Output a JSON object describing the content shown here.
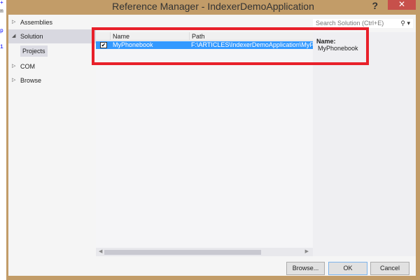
{
  "window": {
    "title": "Reference Manager - IndexerDemoApplication",
    "help": "?",
    "close": "✕"
  },
  "editor_fragments": [
    "+",
    "m",
    "p",
    "1"
  ],
  "nav": {
    "items": [
      {
        "label": "Assemblies",
        "expanded": false
      },
      {
        "label": "Solution",
        "expanded": true,
        "selected": true
      },
      {
        "label": "COM",
        "expanded": false
      },
      {
        "label": "Browse",
        "expanded": false
      }
    ],
    "subitem": "Projects"
  },
  "search": {
    "placeholder": "Search Solution (Ctrl+E)",
    "icon": "search-icon"
  },
  "table": {
    "columns": [
      "Name",
      "Path"
    ],
    "rows": [
      {
        "checked": true,
        "name": "MyPhonebook",
        "path": "F:\\ARTICLES\\IndexerDemoApplication\\MyPhonebook"
      }
    ]
  },
  "details": {
    "label": "Name:",
    "value": "MyPhonebook"
  },
  "buttons": {
    "browse": "Browse...",
    "ok": "OK",
    "cancel": "Cancel"
  },
  "colors": {
    "frame": "#c29c68",
    "selection": "#3399ff",
    "highlight": "#e8202a"
  }
}
